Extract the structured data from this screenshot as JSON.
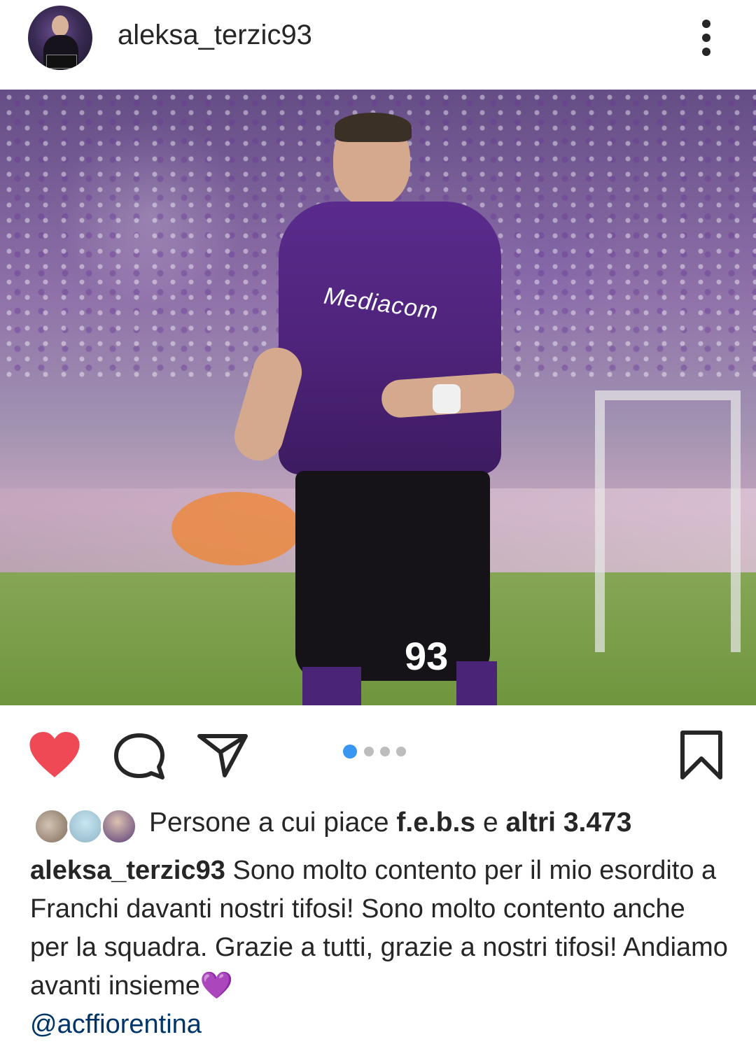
{
  "post": {
    "username": "aleksa_terzic93",
    "image_carousel": {
      "total": 4,
      "active": 1
    },
    "likes": {
      "prefix": "Persone a cui piace",
      "user": "f.e.b.s",
      "connector": "e",
      "others": "altri 3.473"
    },
    "caption": {
      "username": "aleksa_terzic93",
      "text": "Sono molto contento per il mio esordito a Franchi davanti nostri tifosi! Sono molto contento anche per la squadra. Grazie a tutti, grazie a nostri tifosi! Andiamo avanti insieme💜",
      "mention": "@acffiorentina"
    }
  },
  "photo": {
    "sponsor": "Mediacom",
    "number": "93"
  },
  "colors": {
    "heart": "#ef4956",
    "text": "#262626",
    "active_dot": "#3897f0",
    "inactive_dot": "#bdbdbd",
    "mention": "#003569"
  },
  "icons": {
    "more": "more-icon",
    "heart": "heart-icon",
    "comment": "comment-icon",
    "share": "share-icon",
    "bookmark": "bookmark-icon"
  }
}
